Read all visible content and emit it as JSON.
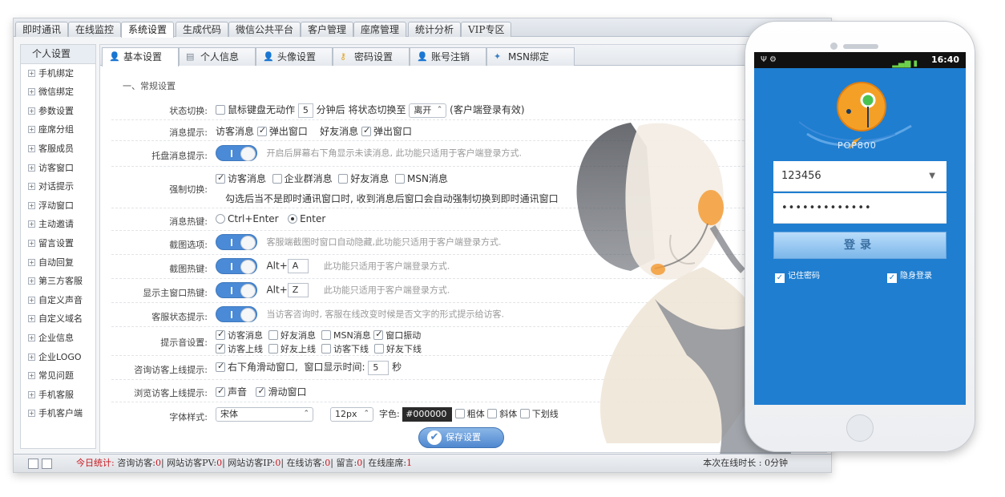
{
  "top_tabs": [
    "即时通讯",
    "在线监控",
    "系统设置",
    "生成代码",
    "微信公共平台",
    "客户管理",
    "座席管理",
    "统计分析",
    "VIP专区"
  ],
  "top_tab_active": "系统设置",
  "sidebar": {
    "items": [
      "个人设置",
      "手机绑定",
      "微信绑定",
      "参数设置",
      "座席分组",
      "客服成员",
      "访客窗口",
      "对话提示",
      "浮动窗口",
      "主动邀请",
      "留言设置",
      "自动回复",
      "第三方客服",
      "自定义声音",
      "自定义域名",
      "企业信息",
      "企业LOGO",
      "常见问题",
      "手机客服",
      "手机客户端"
    ]
  },
  "sub_tabs": [
    {
      "label": "基本设置",
      "icon": "person-icon"
    },
    {
      "label": "个人信息",
      "icon": "id-card-icon"
    },
    {
      "label": "头像设置",
      "icon": "person-icon"
    },
    {
      "label": "密码设置",
      "icon": "key-icon"
    },
    {
      "label": "账号注销",
      "icon": "person-icon"
    },
    {
      "label": "MSN绑定",
      "icon": "msn-icon"
    }
  ],
  "section_title": "一、常规设置",
  "rows": {
    "status_switch": {
      "label": "状态切换:",
      "text1": "鼠标键盘无动作",
      "minutes": "5",
      "text2": "分钟后 将状态切换至",
      "status": "离开",
      "note": "(客户端登录有效)"
    },
    "msg_prompt": {
      "label": "消息提示:",
      "visitor": "访客消息",
      "popup1": "弹出窗口",
      "friend": "好友消息",
      "popup2": "弹出窗口"
    },
    "tray_prompt": {
      "label": "托盘消息提示:",
      "hint": "开启后屏幕右下角显示未读消息, 此功能只适用于客户端登录方式."
    },
    "force_switch": {
      "label": "强制切换:",
      "opts": [
        "访客消息",
        "企业群消息",
        "好友消息",
        "MSN消息"
      ],
      "hint": "勾选后当不是即时通讯窗口时, 收到消息后窗口会自动强制切换到即时通讯窗口"
    },
    "hotkey": {
      "label": "消息热键:",
      "opt1": "Ctrl+Enter",
      "opt2": "Enter"
    },
    "screenshot": {
      "label": "截图选项:",
      "hint": "客服端截图时窗口自动隐藏,此功能只适用于客户端登录方式."
    },
    "screenshot_key": {
      "label": "截图热键:",
      "prefix": "Alt+",
      "key": "A",
      "hint": "此功能只适用于客户端登录方式."
    },
    "main_key": {
      "label": "显示主窗口热键:",
      "prefix": "Alt+",
      "key": "Z",
      "hint": "此功能只适用于客户端登录方式."
    },
    "cs_status": {
      "label": "客服状态提示:",
      "hint": "当访客咨询时, 客服在线改变时候是否文字的形式提示给访客."
    },
    "sound": {
      "label": "提示音设置:",
      "line1": [
        "访客消息",
        "好友消息",
        "MSN消息",
        "窗口振动"
      ],
      "line2": [
        "访客上线",
        "好友上线",
        "访客下线",
        "好友下线"
      ]
    },
    "consult_online": {
      "label": "咨询访客上线提示:",
      "text1": "右下角滑动窗口,",
      "text2": "窗口显示时间:",
      "seconds": "5",
      "unit": "秒"
    },
    "browse_online": {
      "label": "浏览访客上线提示:",
      "opt1": "声音",
      "opt2": "滑动窗口"
    },
    "font": {
      "label": "字体样式:",
      "family": "宋体",
      "size": "12px",
      "color_label": "字色:",
      "color": "#000000",
      "bold": "粗体",
      "italic": "斜体",
      "underline": "下划线"
    }
  },
  "save_label": "保存设置",
  "status_bar": {
    "today": "今日统计:",
    "items": [
      {
        "label": "咨询访客:",
        "value": "0"
      },
      {
        "label": "网站访客PV:",
        "value": "0"
      },
      {
        "label": "网站访客IP:",
        "value": "0"
      },
      {
        "label": "在线访客:",
        "value": "0"
      },
      {
        "label": "留言:",
        "value": "0"
      },
      {
        "label": "在线座席:",
        "value": "1"
      }
    ],
    "online_time": "本次在线时长 : 0分钟"
  },
  "phone": {
    "time": "16:40",
    "brand": "POP800",
    "account": "123456",
    "password": "•••••••••••••",
    "login": "登录",
    "remember": "记住密码",
    "hidden": "隐身登录"
  },
  "colors": {
    "accent": "#1f7ed0",
    "toggle": "#4a8ad6",
    "stat_red": "#c8161d"
  }
}
